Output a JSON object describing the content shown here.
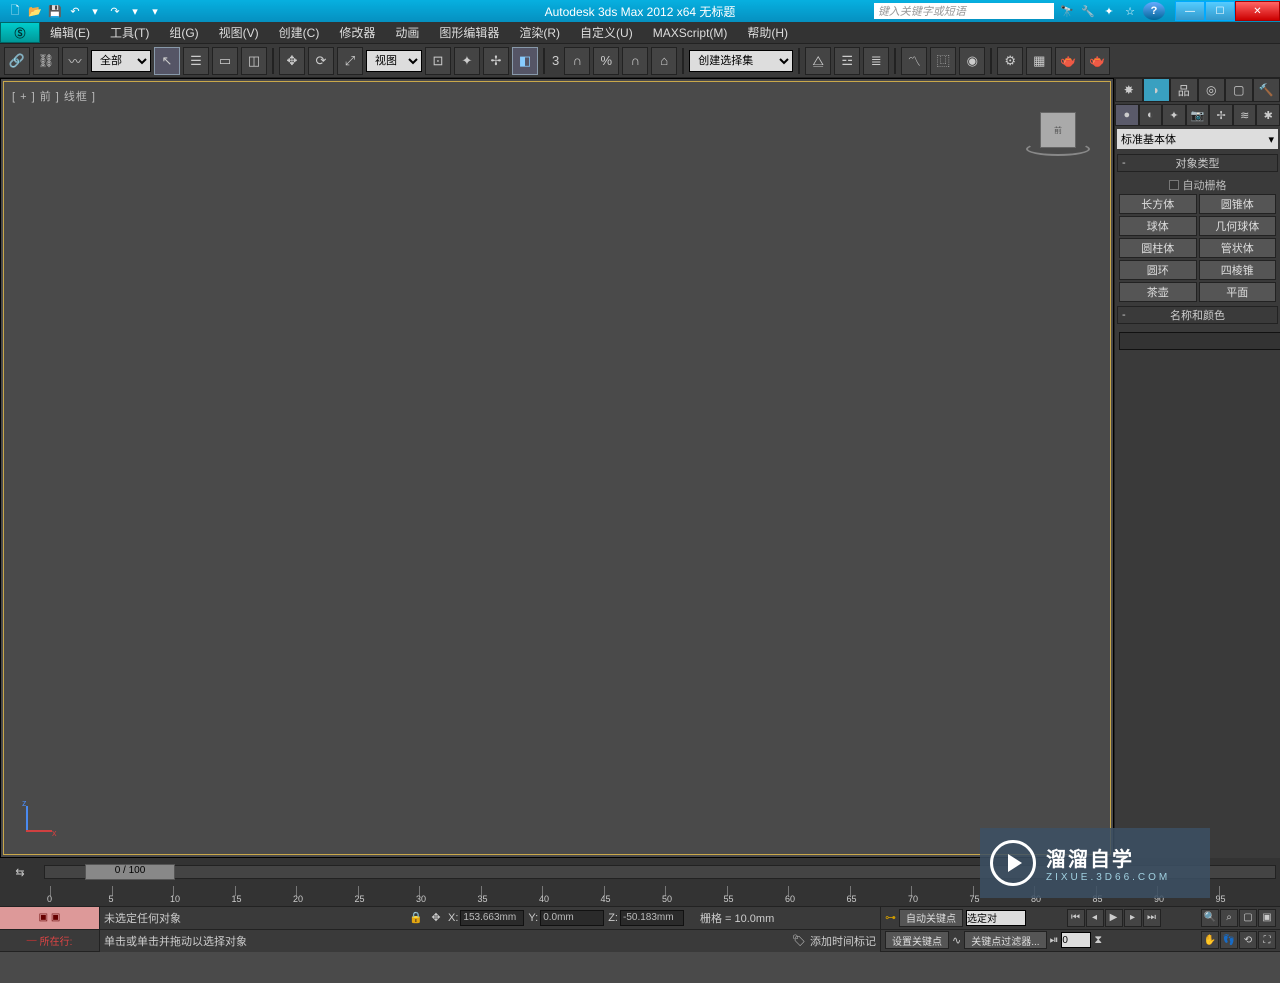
{
  "title": "Autodesk 3ds Max  2012 x64       无标题",
  "search_placeholder": "键入关键字或短语",
  "menubar": [
    "编辑(E)",
    "工具(T)",
    "组(G)",
    "视图(V)",
    "创建(C)",
    "修改器",
    "动画",
    "图形编辑器",
    "渲染(R)",
    "自定义(U)",
    "MAXScript(M)",
    "帮助(H)"
  ],
  "toolbar": {
    "filter_label": "全部",
    "refsys_label": "视图",
    "namedset_label": "创建选择集"
  },
  "viewport": {
    "label": "[ + ] 前 ] 线框 ]",
    "cube_face": "前"
  },
  "cmd": {
    "drop": "标准基本体",
    "rollout1": "对象类型",
    "autogrid": "自动栅格",
    "objects": [
      "长方体",
      "圆锥体",
      "球体",
      "几何球体",
      "圆柱体",
      "管状体",
      "圆环",
      "四棱锥",
      "茶壶",
      "平面"
    ],
    "rollout2": "名称和颜色"
  },
  "timeline": {
    "pos": "0 / 100",
    "ticks": [
      0,
      5,
      10,
      15,
      20,
      25,
      30,
      35,
      40,
      45,
      50,
      55,
      60,
      65,
      70,
      75,
      80,
      85,
      90,
      95
    ]
  },
  "status": {
    "row_loc": "所在行:",
    "sel_none": "未选定任何对象",
    "hint": "单击或单击并拖动以选择对象",
    "x": "153.663mm",
    "y": "0.0mm",
    "z": "-50.183mm",
    "grid": "栅格 = 10.0mm",
    "add_marker": "添加时间标记",
    "auto_key": "自动关键点",
    "sel_drop": "选定对",
    "set_key": "设置关键点",
    "filter": "关键点过滤器...",
    "frame": "0"
  },
  "watermark": {
    "big": "溜溜自学",
    "small": "ZIXUE.3D66.COM"
  }
}
